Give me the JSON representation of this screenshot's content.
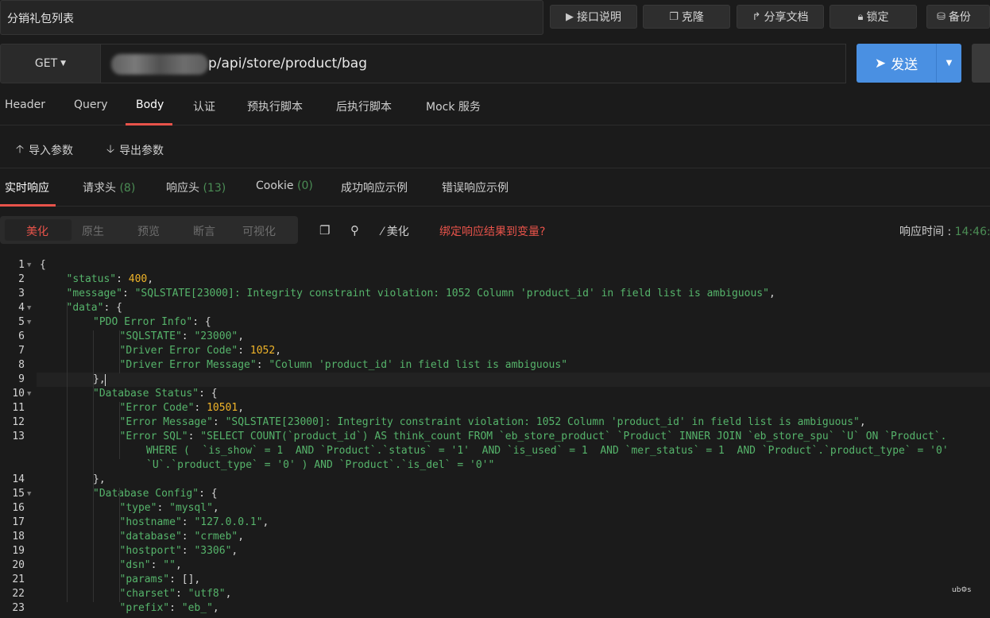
{
  "top": {
    "title": "分销礼包列表",
    "buttons": [
      {
        "icon": "play-icon",
        "label": "接口说明"
      },
      {
        "icon": "clone-icon",
        "label": "克隆"
      },
      {
        "icon": "share-icon",
        "label": "分享文档"
      },
      {
        "icon": "lock-icon",
        "label": "锁定"
      },
      {
        "icon": "database-icon",
        "label": "备份"
      }
    ]
  },
  "request": {
    "method": "GET",
    "url_visible": "p/api/store/product/bag",
    "send_label": "发送"
  },
  "request_tabs": [
    "Header",
    "Query",
    "Body",
    "认证",
    "预执行脚本",
    "后执行脚本",
    "Mock 服务"
  ],
  "request_tab_active": "Body",
  "params": {
    "import_label": "导入参数",
    "export_label": "导出参数"
  },
  "response_tabs": [
    {
      "label": "实时响应",
      "count": ""
    },
    {
      "label": "请求头",
      "count": "(8)"
    },
    {
      "label": "响应头",
      "count": "(13)"
    },
    {
      "label": "Cookie",
      "count": "(0)"
    },
    {
      "label": "成功响应示例",
      "count": ""
    },
    {
      "label": "错误响应示例",
      "count": ""
    }
  ],
  "view_modes": [
    "美化",
    "原生",
    "预览",
    "断言",
    "可视化"
  ],
  "view_mode_active": "美化",
  "toolbar": {
    "beautify_label": "美化",
    "bind_var_label": "绑定响应结果到变量?",
    "resp_time_label": "响应时间 : ",
    "resp_time_value": "14:46:"
  },
  "code_lines": [
    {
      "n": "1",
      "fold": true,
      "indent": 0,
      "parts": [
        [
          "p",
          "{"
        ]
      ]
    },
    {
      "n": "2",
      "fold": false,
      "indent": 1,
      "parts": [
        [
          "k",
          "\"status\""
        ],
        [
          "p",
          ": "
        ],
        [
          "n",
          "400"
        ],
        [
          "p",
          ","
        ]
      ]
    },
    {
      "n": "3",
      "fold": false,
      "indent": 1,
      "parts": [
        [
          "k",
          "\"message\""
        ],
        [
          "p",
          ": "
        ],
        [
          "s",
          "\"SQLSTATE[23000]: Integrity constraint violation: 1052 Column 'product_id' in field list is ambiguous\""
        ],
        [
          "p",
          ","
        ]
      ]
    },
    {
      "n": "4",
      "fold": true,
      "indent": 1,
      "parts": [
        [
          "k",
          "\"data\""
        ],
        [
          "p",
          ": {"
        ]
      ]
    },
    {
      "n": "5",
      "fold": true,
      "indent": 2,
      "parts": [
        [
          "k",
          "\"PDO Error Info\""
        ],
        [
          "p",
          ": {"
        ]
      ]
    },
    {
      "n": "6",
      "fold": false,
      "indent": 3,
      "parts": [
        [
          "k",
          "\"SQLSTATE\""
        ],
        [
          "p",
          ": "
        ],
        [
          "s",
          "\"23000\""
        ],
        [
          "p",
          ","
        ]
      ]
    },
    {
      "n": "7",
      "fold": false,
      "indent": 3,
      "parts": [
        [
          "k",
          "\"Driver Error Code\""
        ],
        [
          "p",
          ": "
        ],
        [
          "n",
          "1052"
        ],
        [
          "p",
          ","
        ]
      ]
    },
    {
      "n": "8",
      "fold": false,
      "indent": 3,
      "parts": [
        [
          "k",
          "\"Driver Error Message\""
        ],
        [
          "p",
          ": "
        ],
        [
          "s",
          "\"Column 'product_id' in field list is ambiguous\""
        ]
      ]
    },
    {
      "n": "9",
      "fold": false,
      "indent": 2,
      "parts": [
        [
          "p",
          "},"
        ]
      ]
    },
    {
      "n": "10",
      "fold": true,
      "indent": 2,
      "parts": [
        [
          "k",
          "\"Database Status\""
        ],
        [
          "p",
          ": {"
        ]
      ]
    },
    {
      "n": "11",
      "fold": false,
      "indent": 3,
      "parts": [
        [
          "k",
          "\"Error Code\""
        ],
        [
          "p",
          ": "
        ],
        [
          "n",
          "10501"
        ],
        [
          "p",
          ","
        ]
      ]
    },
    {
      "n": "12",
      "fold": false,
      "indent": 3,
      "parts": [
        [
          "k",
          "\"Error Message\""
        ],
        [
          "p",
          ": "
        ],
        [
          "s",
          "\"SQLSTATE[23000]: Integrity constraint violation: 1052 Column 'product_id' in field list is ambiguous\""
        ],
        [
          "p",
          ","
        ]
      ]
    },
    {
      "n": "13",
      "fold": false,
      "indent": 3,
      "parts": [
        [
          "k",
          "\"Error SQL\""
        ],
        [
          "p",
          ": "
        ],
        [
          "s",
          "\"SELECT COUNT(`product_id`) AS think_count FROM `eb_store_product` `Product` INNER JOIN `eb_store_spu` `U` ON `Product`."
        ]
      ]
    },
    {
      "n": "",
      "fold": false,
      "indent": 4,
      "parts": [
        [
          "s",
          "WHERE (  `is_show` = 1  AND `Product`.`status` = '1'  AND `is_used` = 1  AND `mer_status` = 1  AND `Product`.`product_type` = '0'"
        ]
      ]
    },
    {
      "n": "",
      "fold": false,
      "indent": 4,
      "parts": [
        [
          "s",
          "`U`.`product_type` = '0' ) AND `Product`.`is_del` = '0'\""
        ]
      ]
    },
    {
      "n": "14",
      "fold": false,
      "indent": 2,
      "parts": [
        [
          "p",
          "},"
        ]
      ]
    },
    {
      "n": "15",
      "fold": true,
      "indent": 2,
      "parts": [
        [
          "k",
          "\"Database Config\""
        ],
        [
          "p",
          ": {"
        ]
      ]
    },
    {
      "n": "16",
      "fold": false,
      "indent": 3,
      "parts": [
        [
          "k",
          "\"type\""
        ],
        [
          "p",
          ": "
        ],
        [
          "s",
          "\"mysql\""
        ],
        [
          "p",
          ","
        ]
      ]
    },
    {
      "n": "17",
      "fold": false,
      "indent": 3,
      "parts": [
        [
          "k",
          "\"hostname\""
        ],
        [
          "p",
          ": "
        ],
        [
          "s",
          "\"127.0.0.1\""
        ],
        [
          "p",
          ","
        ]
      ]
    },
    {
      "n": "18",
      "fold": false,
      "indent": 3,
      "parts": [
        [
          "k",
          "\"database\""
        ],
        [
          "p",
          ": "
        ],
        [
          "s",
          "\"crmeb\""
        ],
        [
          "p",
          ","
        ]
      ]
    },
    {
      "n": "19",
      "fold": false,
      "indent": 3,
      "parts": [
        [
          "k",
          "\"hostport\""
        ],
        [
          "p",
          ": "
        ],
        [
          "s",
          "\"3306\""
        ],
        [
          "p",
          ","
        ]
      ]
    },
    {
      "n": "20",
      "fold": false,
      "indent": 3,
      "parts": [
        [
          "k",
          "\"dsn\""
        ],
        [
          "p",
          ": "
        ],
        [
          "s",
          "\"\""
        ],
        [
          "p",
          ","
        ]
      ]
    },
    {
      "n": "21",
      "fold": false,
      "indent": 3,
      "parts": [
        [
          "k",
          "\"params\""
        ],
        [
          "p",
          ": [],"
        ]
      ]
    },
    {
      "n": "22",
      "fold": false,
      "indent": 3,
      "parts": [
        [
          "k",
          "\"charset\""
        ],
        [
          "p",
          ": "
        ],
        [
          "s",
          "\"utf8\""
        ],
        [
          "p",
          ","
        ]
      ]
    },
    {
      "n": "23",
      "fold": false,
      "indent": 3,
      "parts": [
        [
          "k",
          "\"prefix\""
        ],
        [
          "p",
          ": "
        ],
        [
          "s",
          "\"eb_\""
        ],
        [
          "p",
          ","
        ]
      ]
    }
  ],
  "corner_mark": "ub⚙s"
}
